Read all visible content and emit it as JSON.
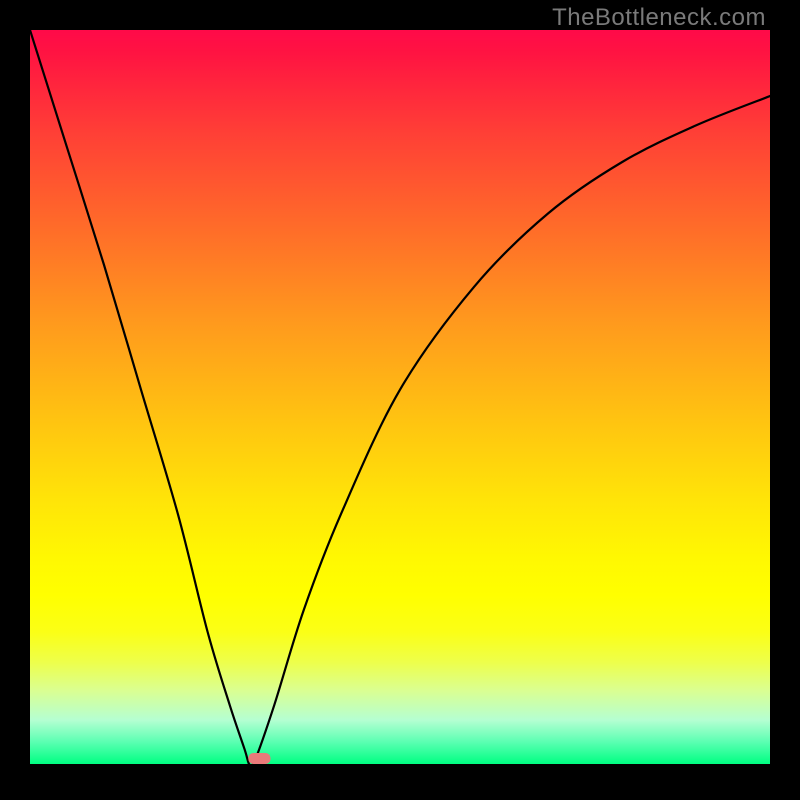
{
  "credit": "TheBottleneck.com",
  "chart_data": {
    "type": "line",
    "title": "",
    "xlabel": "",
    "ylabel": "",
    "xlim": [
      0,
      100
    ],
    "ylim": [
      0,
      100
    ],
    "series": [
      {
        "name": "bottleneck-curve",
        "x": [
          0,
          5,
          10,
          15,
          20,
          24,
          27,
          29,
          29.6,
          30.2,
          33,
          37,
          42,
          50,
          60,
          70,
          80,
          90,
          100
        ],
        "values": [
          100,
          84,
          68,
          51,
          34,
          18,
          8,
          2,
          0,
          0,
          8,
          21,
          34,
          51,
          65,
          75,
          82,
          87,
          91
        ]
      }
    ],
    "marker": {
      "x_range": [
        29.5,
        32.5
      ],
      "y": 0,
      "fill": "#ea7a7a",
      "height_pct": 1.5
    },
    "background_gradient": {
      "type": "linear-vertical",
      "stops": [
        {
          "pct": 0,
          "color": "#ff0a49"
        },
        {
          "pct": 50,
          "color": "#ffc311"
        },
        {
          "pct": 77,
          "color": "#ffff00"
        },
        {
          "pct": 100,
          "color": "#00ff82"
        }
      ]
    }
  }
}
